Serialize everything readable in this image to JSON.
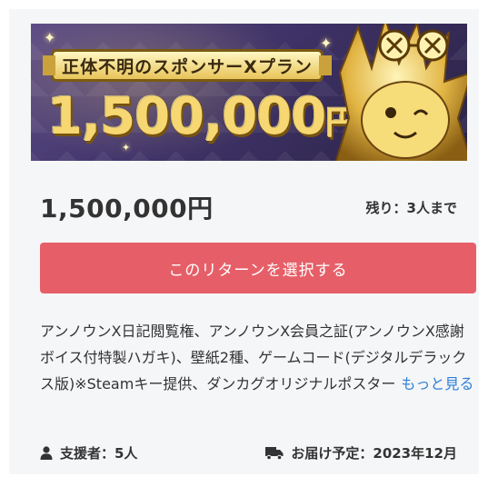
{
  "banner": {
    "ribbon_text": "正体不明のスポンサーXプラン",
    "price_number": "1,500,000",
    "price_unit": "円"
  },
  "plan": {
    "price": "1,500,000円",
    "remaining": "残り：3人まで",
    "select_button": "このリターンを選択する",
    "description": "アンノウンX日記閲覧権、アンノウンX会員之証(アンノウンX感謝ボイス付特製ハガキ)、壁紙2種、ゲームコード(デジタルデラックス版)※Steamキー提供、ダンカグオリジナルポスター",
    "more_link": "もっと見る"
  },
  "footer": {
    "supporters": "支援者：5人",
    "delivery": "お届け予定：2023年12月"
  },
  "icons": {
    "supporters": "user-icon",
    "delivery": "truck-icon"
  },
  "colors": {
    "button": "#e65f68",
    "link": "#2f80d6",
    "card_bg": "#f5f6f8",
    "text": "#333333"
  }
}
